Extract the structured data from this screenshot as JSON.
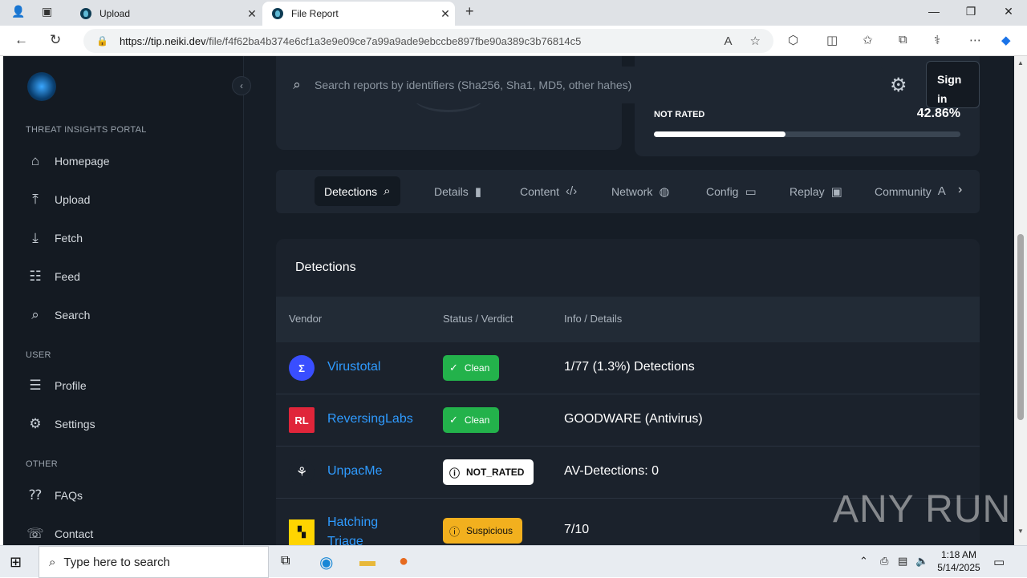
{
  "browser": {
    "tabs": [
      {
        "title": "Upload"
      },
      {
        "title": "File Report"
      }
    ],
    "url_host": "https://tip.neiki.dev",
    "url_path": "/file/f4f62ba4b374e6cf1a3e9e09ce7a99a9ade9ebccbe897fbe90a389c3b76814c5"
  },
  "sidebar": {
    "portal_label": "THREAT INSIGHTS PORTAL",
    "main_items": [
      {
        "label": "Homepage",
        "icon": "home-icon"
      },
      {
        "label": "Upload",
        "icon": "upload-icon"
      },
      {
        "label": "Fetch",
        "icon": "download-icon"
      },
      {
        "label": "Feed",
        "icon": "feed-icon"
      },
      {
        "label": "Search",
        "icon": "search-icon"
      }
    ],
    "user_label": "USER",
    "user_items": [
      {
        "label": "Profile",
        "icon": "profile-icon"
      },
      {
        "label": "Settings",
        "icon": "gear-icon"
      }
    ],
    "other_label": "OTHER",
    "other_items": [
      {
        "label": "FAQs",
        "icon": "faq-icon"
      },
      {
        "label": "Contact",
        "icon": "contact-icon"
      }
    ]
  },
  "header": {
    "search_placeholder": "Search reports by identifiers (Sha256, Sha1, MD5, other hahes)",
    "signin_line1": "Sign",
    "signin_line2": "in"
  },
  "score_card": {
    "label": "NOT RATED",
    "percent_text": "42.86%",
    "percent_value": 42.86
  },
  "report_tabs": [
    {
      "label": "Detections",
      "icon": "search-icon",
      "active": true
    },
    {
      "label": "Details",
      "icon": "file-icon"
    },
    {
      "label": "Content",
      "icon": "code-icon"
    },
    {
      "label": "Network",
      "icon": "globe-icon"
    },
    {
      "label": "Config",
      "icon": "folder-gear-icon"
    },
    {
      "label": "Replay",
      "icon": "play-screen-icon"
    },
    {
      "label": "Community",
      "icon": "community-icon"
    }
  ],
  "detections": {
    "title": "Detections",
    "columns": [
      "Vendor",
      "Status / Verdict",
      "Info / Details"
    ],
    "rows": [
      {
        "vendor": "Virustotal",
        "status": "Clean",
        "status_type": "clean",
        "info": "1/77 (1.3%) Detections",
        "logo_color": "#394eff"
      },
      {
        "vendor": "ReversingLabs",
        "status": "Clean",
        "status_type": "clean",
        "info": "GOODWARE (Antivirus)",
        "logo_color": "#e0253a"
      },
      {
        "vendor": "UnpacMe",
        "status": "NOT_RATED",
        "status_type": "nr",
        "info": "AV-Detections: 0",
        "logo_color": "#1b222c"
      },
      {
        "vendor_line1": "Hatching",
        "vendor_line2": "Triage",
        "status": "Suspicious",
        "status_type": "sus",
        "info": "7/10",
        "logo_color": "#ffd400"
      }
    ]
  },
  "watermark": "ANY RUN",
  "taskbar": {
    "search_placeholder": "Type here to search",
    "time": "1:18 AM",
    "date": "5/14/2025"
  }
}
